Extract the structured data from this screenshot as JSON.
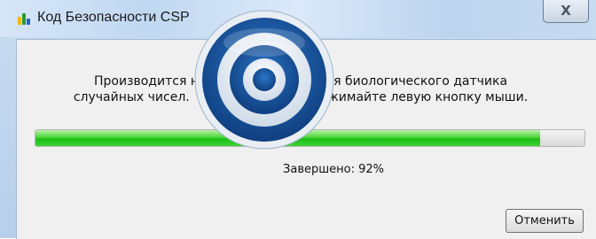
{
  "window": {
    "title": "Код Безопасности CSP",
    "close_label": "X"
  },
  "dialog": {
    "message_line1": "Производится н                              для биологического датчика",
    "message_line2": "случайных чисел.                                 ажимайте левую кнопку мыши.",
    "progress_fraction": 0.92,
    "status_text": "Завершено: 92%",
    "cancel_label": "Отменить"
  },
  "colors": {
    "progress_green": "#1bbf16",
    "target_blue": "#1f5fa8"
  },
  "icons": {
    "app": "app-bars-icon",
    "overlay": "target-icon"
  }
}
